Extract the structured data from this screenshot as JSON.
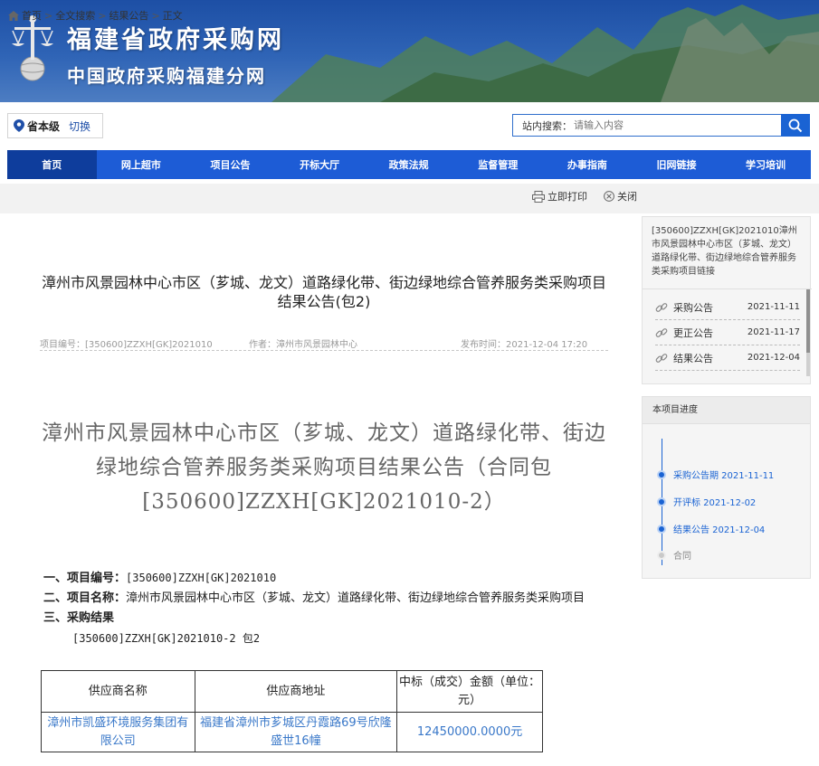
{
  "header": {
    "site_title": "福建省政府采购网",
    "site_subtitle": "中国政府采购福建分网",
    "logo_icon": "scales-of-justice-globe-icon"
  },
  "location": {
    "level": "省本级",
    "switch_label": "切换"
  },
  "search": {
    "label": "站内搜索：",
    "placeholder": "请输入内容",
    "button_icon": "search-icon"
  },
  "nav": {
    "items": [
      {
        "label": "首页",
        "active": true
      },
      {
        "label": "网上超市"
      },
      {
        "label": "项目公告"
      },
      {
        "label": "开标大厅"
      },
      {
        "label": "政策法规"
      },
      {
        "label": "监督管理"
      },
      {
        "label": "办事指南"
      },
      {
        "label": "旧网链接"
      },
      {
        "label": "学习培训"
      }
    ]
  },
  "breadcrumb": {
    "items": [
      "首页",
      "全文搜索",
      "结果公告",
      "正文"
    ],
    "separator": ">"
  },
  "tools": {
    "print_label": "立即打印",
    "close_label": "关闭"
  },
  "article": {
    "title": "漳州市风景园林中心市区（芗城、龙文）道路绿化带、街边绿地综合管养服务类采购项目结果公告(包2)",
    "meta": {
      "project_no_label": "项目编号：",
      "project_no": "[350600]ZZXH[GK]2021010",
      "author_label": "作者：",
      "author": "漳州市风景园林中心",
      "published_label": "发布时间：",
      "published": "2021-12-04 17:20"
    },
    "doc_title": "漳州市风景园林中心市区（芗城、龙文）道路绿化带、街边绿地综合管养服务类采购项目结果公告（合同包[350600]ZZXH[GK]2021010-2）",
    "section1_label": "一、项目编号：",
    "section1_value": "[350600]ZZXH[GK]2021010",
    "section2_label": "二、项目名称：",
    "section2_value": "漳州市风景园林中心市区（芗城、龙文）道路绿化带、街边绿地综合管养服务类采购项目",
    "section3_label": "三、采购结果",
    "package": "[350600]ZZXH[GK]2021010-2 包2",
    "table": {
      "headers": [
        "供应商名称",
        "供应商地址",
        "中标（成交）金额（单位：元）"
      ],
      "rows": [
        [
          "漳州市凯盛环境服务集团有限公司",
          "福建省漳州市芗城区丹霞路69号欣隆盛世16幢",
          "12450000.0000元"
        ]
      ]
    }
  },
  "sidebar": {
    "related_title": "[350600]ZZXH[GK]2021010漳州市风景园林中心市区（芗城、龙文）道路绿化带、街边绿地综合管养服务类采购项目链接",
    "related": [
      {
        "label": "采购公告",
        "date": "2021-11-11"
      },
      {
        "label": "更正公告",
        "date": "2021-11-17"
      },
      {
        "label": "结果公告",
        "date": "2021-12-04"
      }
    ],
    "progress_title": "本项目进度",
    "progress": [
      {
        "label": "采购公告期 2021-11-11",
        "done": true
      },
      {
        "label": "开评标 2021-12-02",
        "done": true
      },
      {
        "label": "结果公告 2021-12-04",
        "done": true
      },
      {
        "label": "合同",
        "done": false
      }
    ]
  },
  "colors": {
    "nav_bg": "#1d5cd6",
    "nav_active": "#0e3d9c",
    "accent_blue": "#1a63d3",
    "table_text": "#3a78c9"
  }
}
